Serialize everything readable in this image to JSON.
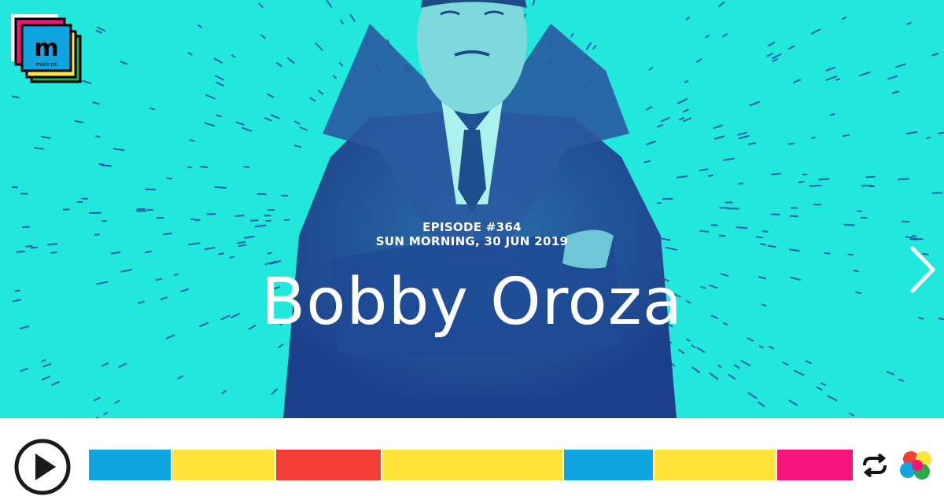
{
  "brand": {
    "logo_text": "m",
    "logo_subtext": "mixlr.ps"
  },
  "episode": {
    "number": "EPISODE #364",
    "date": "SUN MORNING, 30 JUN 2019",
    "title": "Bobby Oroza"
  },
  "colors": {
    "hero_bg": "#22e8dc",
    "seg_blue": "#0ea5e0",
    "seg_yellow": "#ffe53b",
    "seg_red": "#f23c36",
    "seg_pink": "#f5157a"
  },
  "player": {
    "play_icon": "play-icon",
    "repeat_icon": "repeat-icon",
    "platform_icon": "mixcloud-icon",
    "segments": [
      {
        "color": "seg_blue"
      },
      {
        "color": "seg_yellow"
      },
      {
        "color": "seg_red"
      },
      {
        "color": "seg_yellow"
      },
      {
        "color": "seg_blue"
      },
      {
        "color": "seg_yellow"
      },
      {
        "color": "seg_pink"
      }
    ]
  }
}
